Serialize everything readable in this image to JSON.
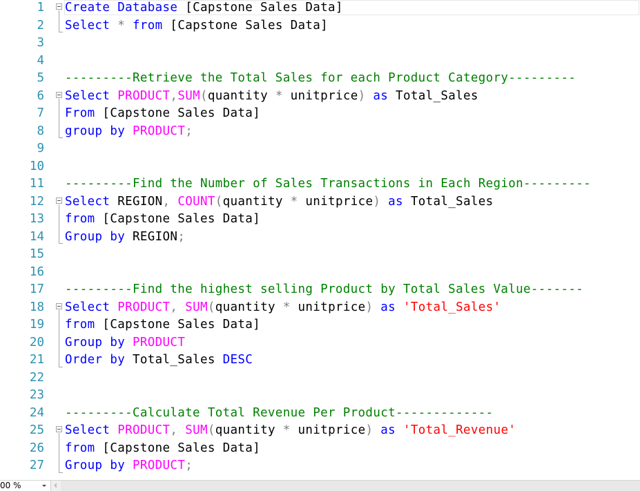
{
  "editor": {
    "lines": [
      {
        "num": "1",
        "fold": true,
        "tokens": [
          {
            "t": "Create",
            "c": "kw"
          },
          {
            "t": " ",
            "c": "tx"
          },
          {
            "t": "Database",
            "c": "kw"
          },
          {
            "t": " [Capstone Sales Data]",
            "c": "tx"
          }
        ]
      },
      {
        "num": "2",
        "fold": false,
        "tokens": [
          {
            "t": "Select",
            "c": "kw"
          },
          {
            "t": " ",
            "c": "tx"
          },
          {
            "t": "*",
            "c": "op"
          },
          {
            "t": " ",
            "c": "tx"
          },
          {
            "t": "from",
            "c": "kw"
          },
          {
            "t": " [Capstone Sales Data]",
            "c": "tx"
          }
        ]
      },
      {
        "num": "3",
        "fold": false,
        "tokens": []
      },
      {
        "num": "4",
        "fold": false,
        "tokens": []
      },
      {
        "num": "5",
        "fold": false,
        "tokens": [
          {
            "t": "---------Retrieve the Total Sales for each Product Category---------",
            "c": "cm"
          }
        ]
      },
      {
        "num": "6",
        "fold": true,
        "tokens": [
          {
            "t": "Select",
            "c": "kw"
          },
          {
            "t": " ",
            "c": "tx"
          },
          {
            "t": "PRODUCT",
            "c": "fn"
          },
          {
            "t": ",",
            "c": "op"
          },
          {
            "t": "SUM",
            "c": "fn"
          },
          {
            "t": "(",
            "c": "op"
          },
          {
            "t": "quantity ",
            "c": "tx"
          },
          {
            "t": "*",
            "c": "op"
          },
          {
            "t": " unitprice",
            "c": "tx"
          },
          {
            "t": ")",
            "c": "op"
          },
          {
            "t": " ",
            "c": "tx"
          },
          {
            "t": "as",
            "c": "kw"
          },
          {
            "t": " Total_Sales",
            "c": "tx"
          }
        ]
      },
      {
        "num": "7",
        "fold": false,
        "tokens": [
          {
            "t": "From",
            "c": "kw"
          },
          {
            "t": " [Capstone Sales Data]",
            "c": "tx"
          }
        ]
      },
      {
        "num": "8",
        "fold": false,
        "tokens": [
          {
            "t": "group",
            "c": "kw"
          },
          {
            "t": " ",
            "c": "tx"
          },
          {
            "t": "by",
            "c": "kw"
          },
          {
            "t": " ",
            "c": "tx"
          },
          {
            "t": "PRODUCT",
            "c": "fn"
          },
          {
            "t": ";",
            "c": "op"
          }
        ]
      },
      {
        "num": "9",
        "fold": false,
        "tokens": []
      },
      {
        "num": "10",
        "fold": false,
        "tokens": []
      },
      {
        "num": "11",
        "fold": false,
        "tokens": [
          {
            "t": "---------Find the Number of Sales Transactions in Each Region---------",
            "c": "cm"
          }
        ]
      },
      {
        "num": "12",
        "fold": true,
        "tokens": [
          {
            "t": "Select",
            "c": "kw"
          },
          {
            "t": " REGION",
            "c": "tx"
          },
          {
            "t": ",",
            "c": "op"
          },
          {
            "t": " ",
            "c": "tx"
          },
          {
            "t": "COUNT",
            "c": "fn"
          },
          {
            "t": "(",
            "c": "op"
          },
          {
            "t": "quantity ",
            "c": "tx"
          },
          {
            "t": "*",
            "c": "op"
          },
          {
            "t": " unitprice",
            "c": "tx"
          },
          {
            "t": ")",
            "c": "op"
          },
          {
            "t": " ",
            "c": "tx"
          },
          {
            "t": "as",
            "c": "kw"
          },
          {
            "t": " Total_Sales",
            "c": "tx"
          }
        ]
      },
      {
        "num": "13",
        "fold": false,
        "tokens": [
          {
            "t": "from",
            "c": "kw"
          },
          {
            "t": " [Capstone Sales Data]",
            "c": "tx"
          }
        ]
      },
      {
        "num": "14",
        "fold": false,
        "tokens": [
          {
            "t": "Group",
            "c": "kw"
          },
          {
            "t": " ",
            "c": "tx"
          },
          {
            "t": "by",
            "c": "kw"
          },
          {
            "t": " REGION",
            "c": "tx"
          },
          {
            "t": ";",
            "c": "op"
          }
        ]
      },
      {
        "num": "15",
        "fold": false,
        "tokens": []
      },
      {
        "num": "16",
        "fold": false,
        "tokens": []
      },
      {
        "num": "17",
        "fold": false,
        "tokens": [
          {
            "t": "---------Find the highest selling Product by Total Sales Value-------",
            "c": "cm"
          }
        ]
      },
      {
        "num": "18",
        "fold": true,
        "tokens": [
          {
            "t": "Select",
            "c": "kw"
          },
          {
            "t": " ",
            "c": "tx"
          },
          {
            "t": "PRODUCT",
            "c": "fn"
          },
          {
            "t": ",",
            "c": "op"
          },
          {
            "t": " ",
            "c": "tx"
          },
          {
            "t": "SUM",
            "c": "fn"
          },
          {
            "t": "(",
            "c": "op"
          },
          {
            "t": "quantity ",
            "c": "tx"
          },
          {
            "t": "*",
            "c": "op"
          },
          {
            "t": " unitprice",
            "c": "tx"
          },
          {
            "t": ")",
            "c": "op"
          },
          {
            "t": " ",
            "c": "tx"
          },
          {
            "t": "as",
            "c": "kw"
          },
          {
            "t": " ",
            "c": "tx"
          },
          {
            "t": "'Total_Sales'",
            "c": "st"
          }
        ]
      },
      {
        "num": "19",
        "fold": false,
        "tokens": [
          {
            "t": "from",
            "c": "kw"
          },
          {
            "t": " [Capstone Sales Data]",
            "c": "tx"
          }
        ]
      },
      {
        "num": "20",
        "fold": false,
        "tokens": [
          {
            "t": "Group",
            "c": "kw"
          },
          {
            "t": " ",
            "c": "tx"
          },
          {
            "t": "by",
            "c": "kw"
          },
          {
            "t": " ",
            "c": "tx"
          },
          {
            "t": "PRODUCT",
            "c": "fn"
          }
        ]
      },
      {
        "num": "21",
        "fold": false,
        "tokens": [
          {
            "t": "Order",
            "c": "kw"
          },
          {
            "t": " ",
            "c": "tx"
          },
          {
            "t": "by",
            "c": "kw"
          },
          {
            "t": " Total_Sales ",
            "c": "tx"
          },
          {
            "t": "DESC",
            "c": "kw"
          }
        ]
      },
      {
        "num": "22",
        "fold": false,
        "tokens": []
      },
      {
        "num": "23",
        "fold": false,
        "tokens": []
      },
      {
        "num": "24",
        "fold": false,
        "tokens": [
          {
            "t": "---------Calculate Total Revenue Per Product-------------",
            "c": "cm"
          }
        ]
      },
      {
        "num": "25",
        "fold": true,
        "tokens": [
          {
            "t": "Select",
            "c": "kw"
          },
          {
            "t": " ",
            "c": "tx"
          },
          {
            "t": "PRODUCT",
            "c": "fn"
          },
          {
            "t": ",",
            "c": "op"
          },
          {
            "t": " ",
            "c": "tx"
          },
          {
            "t": "SUM",
            "c": "fn"
          },
          {
            "t": "(",
            "c": "op"
          },
          {
            "t": "quantity ",
            "c": "tx"
          },
          {
            "t": "*",
            "c": "op"
          },
          {
            "t": " unitprice",
            "c": "tx"
          },
          {
            "t": ")",
            "c": "op"
          },
          {
            "t": " ",
            "c": "tx"
          },
          {
            "t": "as",
            "c": "kw"
          },
          {
            "t": " ",
            "c": "tx"
          },
          {
            "t": "'Total_Revenue'",
            "c": "st"
          }
        ]
      },
      {
        "num": "26",
        "fold": false,
        "tokens": [
          {
            "t": "from",
            "c": "kw"
          },
          {
            "t": " [Capstone Sales Data]",
            "c": "tx"
          }
        ]
      },
      {
        "num": "27",
        "fold": false,
        "tokens": [
          {
            "t": "Group",
            "c": "kw"
          },
          {
            "t": " ",
            "c": "tx"
          },
          {
            "t": "by",
            "c": "kw"
          },
          {
            "t": " ",
            "c": "tx"
          },
          {
            "t": "PRODUCT",
            "c": "fn"
          },
          {
            "t": ";",
            "c": "op"
          }
        ]
      }
    ]
  },
  "status_bar": {
    "zoom": "00 %"
  },
  "colors": {
    "keyword": "#0000ff",
    "function": "#ff00ff",
    "comment": "#008000",
    "operator": "#808080",
    "string": "#ff0000",
    "line_number": "#2b91af"
  }
}
